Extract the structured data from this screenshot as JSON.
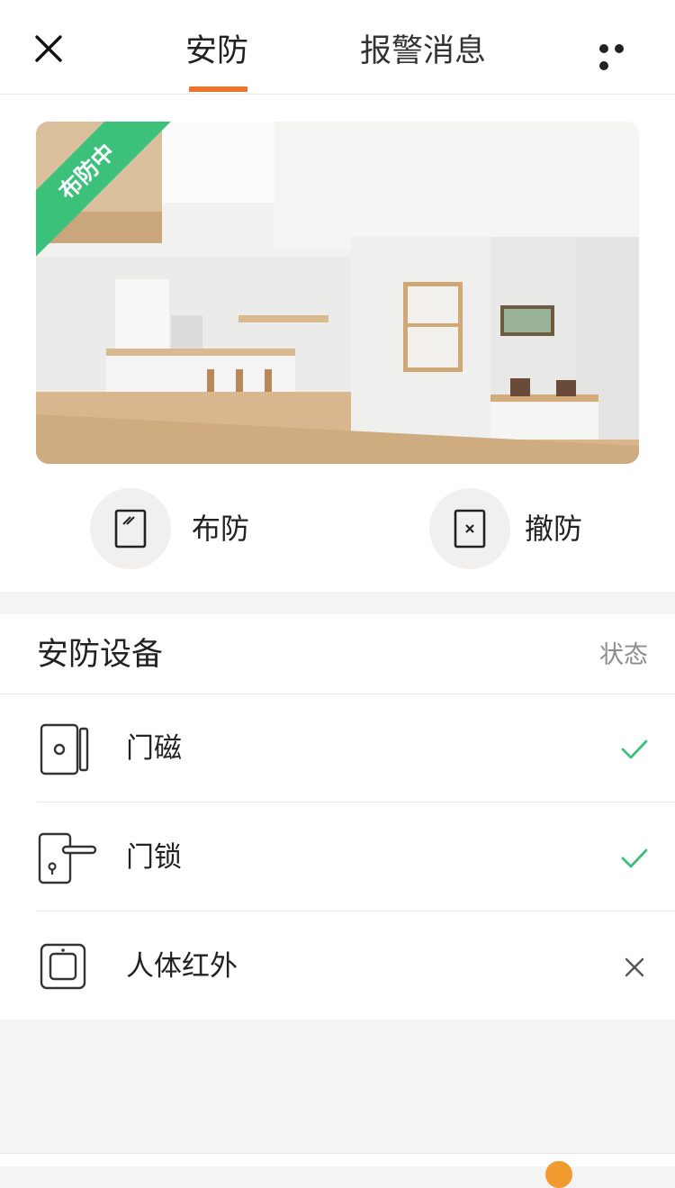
{
  "header": {
    "tabs": [
      {
        "label": "安防",
        "active": true
      },
      {
        "label": "报警消息",
        "active": false
      }
    ],
    "close_icon": "close-icon",
    "more_icon": "more-icon"
  },
  "hero": {
    "mode_badge": "布防中",
    "badge_color": "#3cc17a",
    "image": "living-room-photo"
  },
  "actions": {
    "arm_label": "布防",
    "disarm_label": "撤防"
  },
  "devices": {
    "title": "安防设备",
    "status_header": "状态",
    "items": [
      {
        "name": "门磁",
        "icon": "door-sensor-icon",
        "status": "ok"
      },
      {
        "name": "门锁",
        "icon": "door-lock-icon",
        "status": "ok"
      },
      {
        "name": "人体红外",
        "icon": "motion-sensor-icon",
        "status": "off"
      }
    ]
  },
  "colors": {
    "accent": "#e8742e",
    "ok": "#3cc17a",
    "off": "#555555"
  }
}
